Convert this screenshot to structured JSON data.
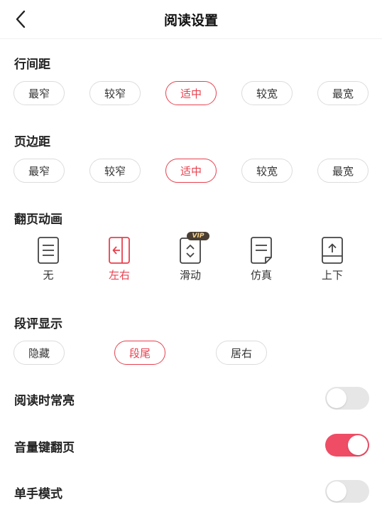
{
  "header": {
    "title": "阅读设置"
  },
  "line_spacing": {
    "title": "行间距",
    "options": [
      "最窄",
      "较窄",
      "适中",
      "较宽",
      "最宽"
    ],
    "selected": "适中"
  },
  "page_margin": {
    "title": "页边距",
    "options": [
      "最窄",
      "较窄",
      "适中",
      "较宽",
      "最宽"
    ],
    "selected": "适中"
  },
  "page_animation": {
    "title": "翻页动画",
    "options": [
      {
        "label": "无",
        "icon": "page-lines-icon"
      },
      {
        "label": "左右",
        "icon": "page-left-arrow-icon"
      },
      {
        "label": "滑动",
        "icon": "page-updown-chevrons-icon",
        "badge": "VIP"
      },
      {
        "label": "仿真",
        "icon": "page-curl-icon"
      },
      {
        "label": "上下",
        "icon": "page-up-arrow-icon"
      }
    ],
    "selected": "左右"
  },
  "paragraph_comments": {
    "title": "段评显示",
    "options": [
      "隐藏",
      "段尾",
      "居右"
    ],
    "selected": "段尾"
  },
  "toggles": [
    {
      "label": "阅读时常亮",
      "on": false
    },
    {
      "label": "音量键翻页",
      "on": true
    },
    {
      "label": "单手模式",
      "on": false
    }
  ],
  "colors": {
    "accent": "#e8414f",
    "toggle_on": "#ef4d65",
    "toggle_off": "#e6e6e6"
  }
}
